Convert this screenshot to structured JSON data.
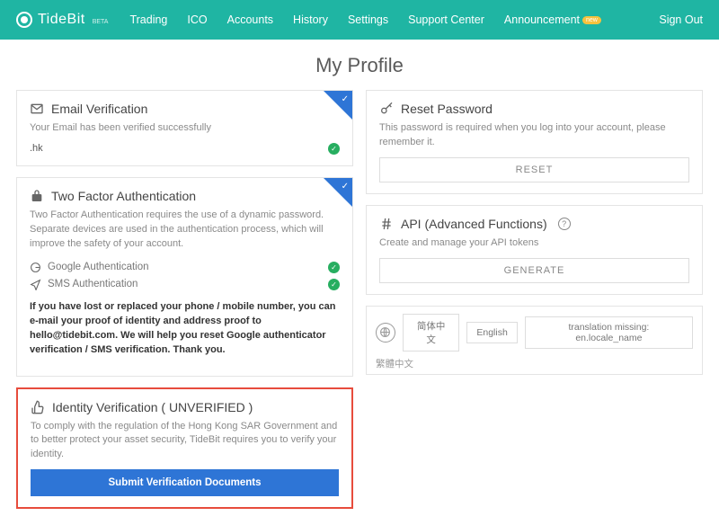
{
  "brand": {
    "name": "TideBit",
    "beta": "BETA"
  },
  "nav": {
    "items": [
      "Trading",
      "ICO",
      "Accounts",
      "History",
      "Settings",
      "Support Center"
    ],
    "announcement": "Announcement",
    "announcement_badge": "new",
    "signout": "Sign Out"
  },
  "page": {
    "title": "My Profile"
  },
  "email_card": {
    "title": "Email Verification",
    "desc": "Your Email has been verified successfully",
    "value": ".hk"
  },
  "tfa_card": {
    "title": "Two Factor Authentication",
    "desc": "Two Factor Authentication requires the use of a dynamic password. Separate devices are used in the authentication process, which will improve the safety of your account.",
    "google": "Google Authentication",
    "sms": "SMS Authentication",
    "note": "If you have lost or replaced your phone / mobile number, you can e-mail your proof of identity and address proof to hello@tidebit.com. We will help you reset Google authenticator verification / SMS verification. Thank you."
  },
  "identity_card": {
    "title": "Identity Verification ( UNVERIFIED )",
    "desc": "To comply with the regulation of the Hong Kong SAR Government and to better protect your asset security, TideBit requires you to verify your identity.",
    "button": "Submit Verification Documents"
  },
  "reset_card": {
    "title": "Reset Password",
    "desc": "This password is required when you log into your account, please remember it.",
    "button": "RESET"
  },
  "api_card": {
    "title": "API (Advanced Functions)",
    "desc": "Create and manage your API tokens",
    "button": "GENERATE"
  },
  "lang": {
    "opts": [
      "简体中文",
      "English",
      "translation missing: en.locale_name"
    ],
    "right": "繁體中文"
  }
}
